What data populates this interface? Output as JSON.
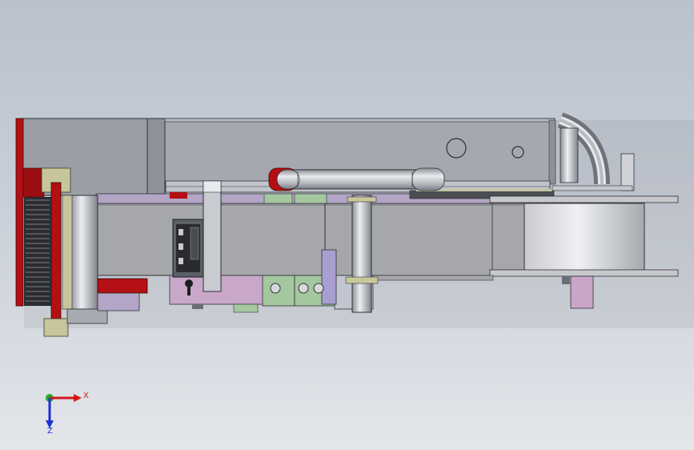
{
  "triad": {
    "x_label": "X",
    "z_label": "Z",
    "colors": {
      "x": "#d21a1a",
      "y": "#1fae2a",
      "z": "#1a2fd2"
    }
  },
  "palette": {
    "body_gray": "#9fa2a8",
    "panel_gray": "#a7aab0",
    "belt_gray": "#a5a6aa",
    "red": "#b40f12",
    "khaki": "#c5c39a",
    "lavender": "#b3a5c6",
    "mint": "#a4c7a0",
    "steel": "#c4c8cf"
  }
}
